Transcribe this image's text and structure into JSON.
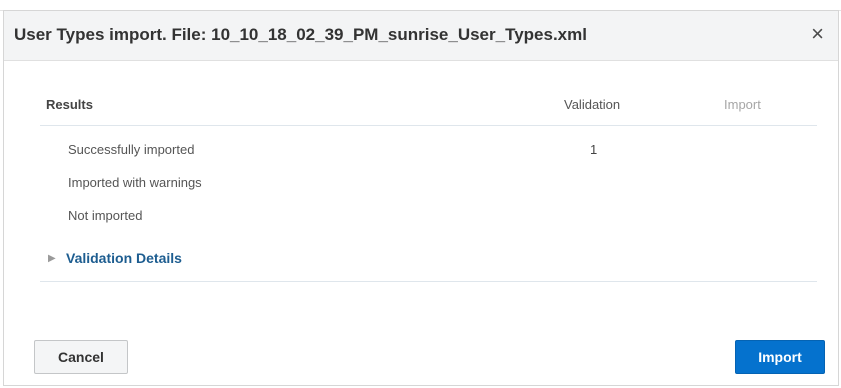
{
  "dialog": {
    "title": "User Types import. File: 10_10_18_02_39_PM_sunrise_User_Types.xml",
    "close_glyph": "×"
  },
  "results": {
    "headers": {
      "results": "Results",
      "validation": "Validation",
      "import": "Import"
    },
    "rows": [
      {
        "label": "Successfully imported",
        "validation": "1",
        "import": ""
      },
      {
        "label": "Imported with warnings",
        "validation": "",
        "import": ""
      },
      {
        "label": "Not imported",
        "validation": "",
        "import": ""
      }
    ]
  },
  "details": {
    "label": "Validation Details",
    "icon": "chevron-right-icon"
  },
  "footer": {
    "cancel_label": "Cancel",
    "import_label": "Import"
  },
  "colors": {
    "primary": "#0572ce",
    "link": "#1d5d90",
    "header_bg": "#f3f4f5"
  }
}
